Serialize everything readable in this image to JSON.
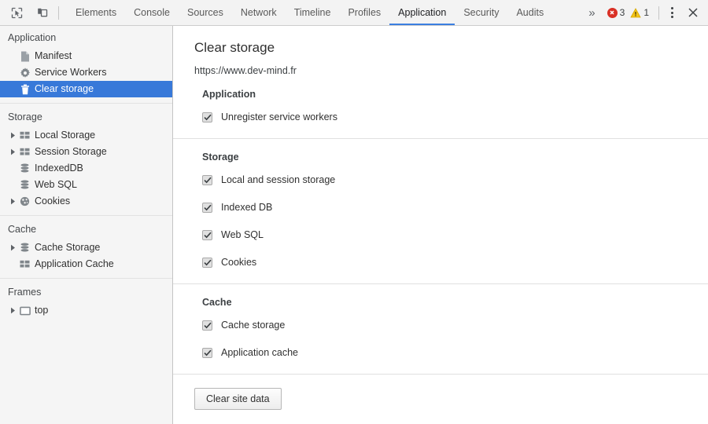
{
  "toolbar": {
    "inspect_icon": "inspect-element-icon",
    "device_icon": "device-toolbar-icon",
    "tabs": [
      {
        "label": "Elements",
        "active": false
      },
      {
        "label": "Console",
        "active": false
      },
      {
        "label": "Sources",
        "active": false
      },
      {
        "label": "Network",
        "active": false
      },
      {
        "label": "Timeline",
        "active": false
      },
      {
        "label": "Profiles",
        "active": false
      },
      {
        "label": "Application",
        "active": true
      },
      {
        "label": "Security",
        "active": false
      },
      {
        "label": "Audits",
        "active": false
      }
    ],
    "overflow_label": "»",
    "error_count": "3",
    "warning_count": "1",
    "menu_icon": "more-vertical-icon",
    "close_icon": "close-icon",
    "active_tab_color": "#3b7fe0",
    "error_color": "#d93025",
    "warning_color": "#f5c518"
  },
  "sidebar": {
    "selection_color": "#3879d9",
    "sections": [
      {
        "title": "Application",
        "items": [
          {
            "label": "Manifest",
            "icon": "document-icon",
            "twisty": false,
            "selected": false
          },
          {
            "label": "Service Workers",
            "icon": "gear-icon",
            "twisty": false,
            "selected": false
          },
          {
            "label": "Clear storage",
            "icon": "trash-icon",
            "twisty": false,
            "selected": true
          }
        ]
      },
      {
        "title": "Storage",
        "items": [
          {
            "label": "Local Storage",
            "icon": "table-icon",
            "twisty": true,
            "selected": false
          },
          {
            "label": "Session Storage",
            "icon": "table-icon",
            "twisty": true,
            "selected": false
          },
          {
            "label": "IndexedDB",
            "icon": "database-icon",
            "twisty": false,
            "selected": false
          },
          {
            "label": "Web SQL",
            "icon": "database-icon",
            "twisty": false,
            "selected": false
          },
          {
            "label": "Cookies",
            "icon": "cookie-icon",
            "twisty": true,
            "selected": false
          }
        ]
      },
      {
        "title": "Cache",
        "items": [
          {
            "label": "Cache Storage",
            "icon": "database-icon",
            "twisty": true,
            "selected": false
          },
          {
            "label": "Application Cache",
            "icon": "table-icon",
            "twisty": false,
            "selected": false
          }
        ]
      },
      {
        "title": "Frames",
        "items": [
          {
            "label": "top",
            "icon": "frame-icon",
            "twisty": true,
            "selected": false
          }
        ]
      }
    ]
  },
  "main": {
    "title": "Clear storage",
    "origin": "https://www.dev-mind.fr",
    "groups": [
      {
        "title": "Application",
        "options": [
          {
            "label": "Unregister service workers",
            "checked": true
          }
        ]
      },
      {
        "title": "Storage",
        "options": [
          {
            "label": "Local and session storage",
            "checked": true
          },
          {
            "label": "Indexed DB",
            "checked": true
          },
          {
            "label": "Web SQL",
            "checked": true
          },
          {
            "label": "Cookies",
            "checked": true
          }
        ]
      },
      {
        "title": "Cache",
        "options": [
          {
            "label": "Cache storage",
            "checked": true
          },
          {
            "label": "Application cache",
            "checked": true
          }
        ]
      }
    ],
    "clear_button_label": "Clear site data"
  }
}
